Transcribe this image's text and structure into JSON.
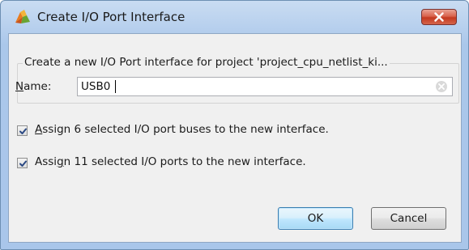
{
  "window": {
    "title": "Create I/O Port Interface",
    "app_icon": "vivado-logo-icon",
    "close_icon": "close-icon"
  },
  "group": {
    "legend": "Create a new I/O Port interface for project 'project_cpu_netlist_ki..."
  },
  "name_field": {
    "label_mnemonic": "N",
    "label_rest": "ame:",
    "value": "USB0",
    "clear_icon": "clear-icon"
  },
  "options": [
    {
      "checked": true,
      "mnemonic": "A",
      "label_rest": "ssign 6 selected I/O port buses to the new interface."
    },
    {
      "checked": true,
      "label_pre": "Assi",
      "mnemonic": "g",
      "label_rest": "n 11 selected I/O ports to the new interface."
    }
  ],
  "buttons": {
    "ok_label": "OK",
    "cancel_label": "Cancel"
  },
  "colors": {
    "close_button": "#c4391f",
    "ok_border": "#3c7fb1",
    "dialog_background": "#f0f0f0"
  }
}
